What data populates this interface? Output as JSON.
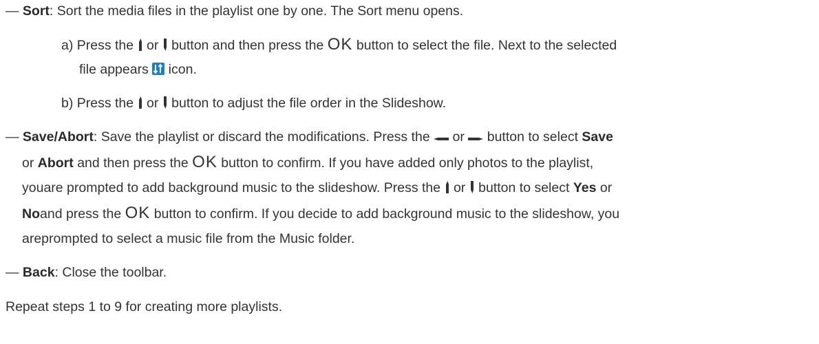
{
  "items": {
    "sort": {
      "dash": "—",
      "label": "Sort",
      "text": ": Sort the media files in the playlist one by one. The Sort menu opens.",
      "a_prefix": "a) Press the",
      "a_or": "or",
      "a_mid": "button and then press the",
      "ok": "OK",
      "a_end": "button to select the file. Next to the selected",
      "a_line2_start": "file appears",
      "a_line2_end": "icon.",
      "b_prefix": "b) Press the",
      "b_or": "or",
      "b_end": "button to adjust the file order in the Slideshow."
    },
    "save": {
      "dash": "—",
      "label": "Save/Abort",
      "l1_text": ": Save the playlist or discard the modifications. Press the",
      "l1_or": "or",
      "l1_mid": "button to select",
      "l1_save": "Save",
      "l2_or": "or",
      "l2_abort": "Abort",
      "l2_text": "and then press the",
      "ok": "OK",
      "l2_end": "button to confirm. If you have added only photos to the playlist,",
      "l3": "youare prompted to add background music to the slideshow. Press the",
      "l3_or": "or",
      "l3_mid": "button to select",
      "l3_yes": "Yes",
      "l3_or2": "or",
      "l4_no": "No",
      "l4_text": "and press the",
      "l4_end": "button to confirm. If you decide to add background music to the slideshow, you",
      "l5": "areprompted to select a music file from the Music folder."
    },
    "back": {
      "dash": "—",
      "label": "Back",
      "text": ": Close the toolbar."
    }
  },
  "footer": "Repeat steps 1 to 9 for creating more playlists.",
  "icons": {
    "up": "up-arrow-button-icon",
    "down": "down-arrow-button-icon",
    "left": "left-arrow-button-icon",
    "right": "right-arrow-button-icon",
    "sort": "sort-marker-icon"
  },
  "colors": {
    "text": "#333333",
    "sort_icon_bg": "#1e7ec8"
  }
}
